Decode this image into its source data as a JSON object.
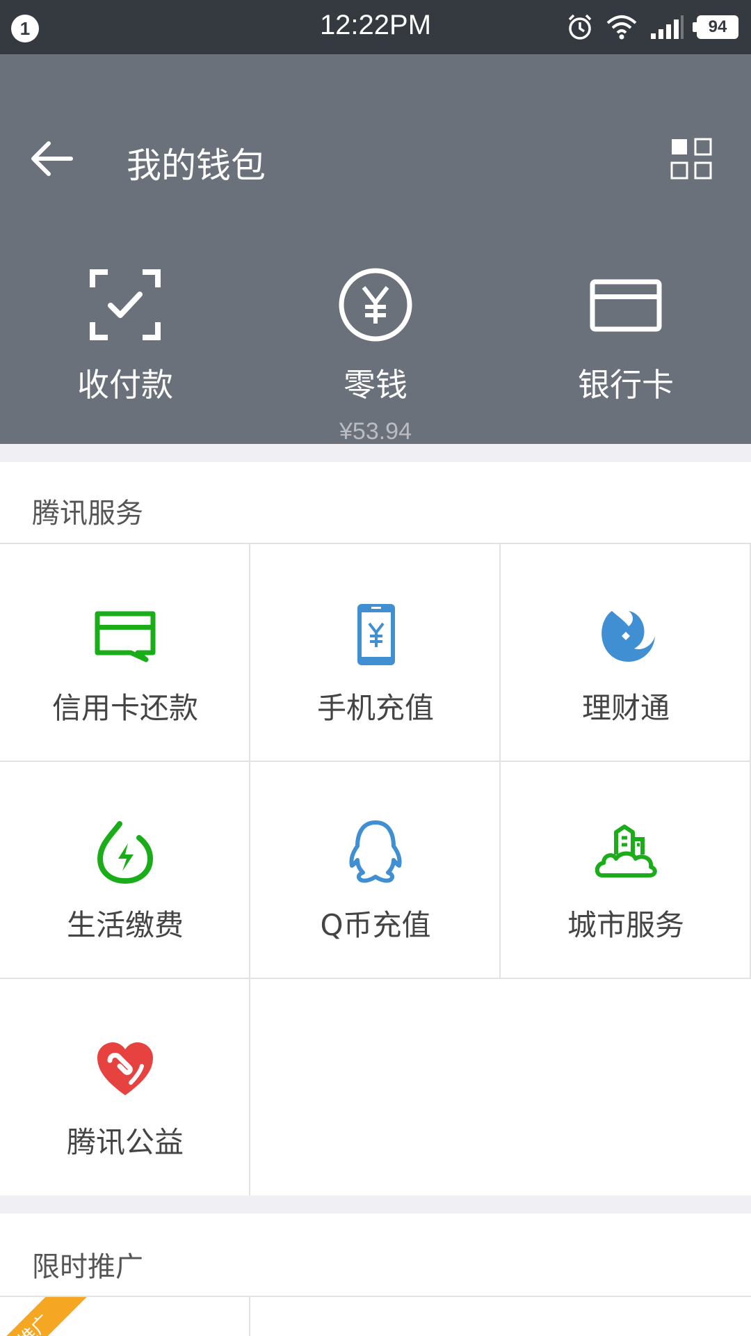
{
  "status_bar": {
    "notification_count": "1",
    "time": "12:22PM",
    "battery": "94",
    "icons": [
      "alarm-icon",
      "wifi-icon",
      "signal-icon",
      "battery-icon"
    ]
  },
  "header": {
    "title": "我的钱包",
    "back_icon": "arrow-left-icon",
    "menu_icon": "grid-icon",
    "background_color": "#6b717b"
  },
  "wallet": {
    "items": [
      {
        "label": "收付款",
        "icon": "scan-pay-icon"
      },
      {
        "label": "零钱",
        "sub": "¥53.94",
        "icon": "yuan-coin-icon"
      },
      {
        "label": "银行卡",
        "icon": "bank-card-icon"
      }
    ]
  },
  "tencent_services": {
    "title": "腾讯服务",
    "items": [
      {
        "label": "信用卡还款",
        "icon": "credit-card-icon",
        "color": "#1aad19"
      },
      {
        "label": "手机充值",
        "icon": "phone-recharge-icon",
        "color": "#3f8fd2"
      },
      {
        "label": "理财通",
        "icon": "licaitong-icon",
        "color": "#3f8fd2"
      },
      {
        "label": "生活缴费",
        "icon": "utility-bill-icon",
        "color": "#1aad19"
      },
      {
        "label": "Q币充值",
        "icon": "qq-penguin-icon",
        "color": "#3f8fd2"
      },
      {
        "label": "城市服务",
        "icon": "city-service-icon",
        "color": "#1aad19"
      },
      {
        "label": "腾讯公益",
        "icon": "charity-heart-icon",
        "color": "#e64340"
      }
    ]
  },
  "promotions": {
    "title": "限时推广",
    "badge": "推广"
  }
}
